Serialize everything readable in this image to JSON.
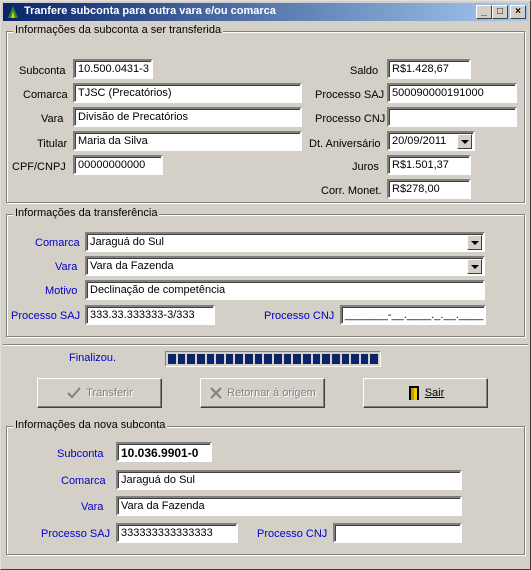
{
  "window": {
    "title": "Tranfere subconta para outra vara e/ou comarca",
    "min_label": "_",
    "max_label": "□",
    "close_label": "×"
  },
  "origem": {
    "title": "Informações da subconta a ser transferida",
    "subconta_label": "Subconta",
    "subconta": "10.500.0431-3",
    "comarca_label": "Comarca",
    "comarca": "TJSC (Precatórios)",
    "vara_label": "Vara",
    "vara": "Divisão de Precatórios",
    "titular_label": "Titular",
    "titular": "Maria da Silva",
    "cpf_label": "CPF/CNPJ",
    "cpf": "00000000000",
    "saldo_label": "Saldo",
    "saldo": "R$1.428,67",
    "saj_label": "Processo SAJ",
    "saj": "500090000191000",
    "cnj_label": "Processo CNJ",
    "cnj": "",
    "aniv_label": "Dt. Aniversário",
    "aniv": "20/09/2011",
    "juros_label": "Juros",
    "juros": "R$1.501,37",
    "corr_label": "Corr. Monet.",
    "corr": "R$278,00"
  },
  "transferencia": {
    "title": "Informações da transferência",
    "comarca_label": "Comarca",
    "comarca": "Jaraguá do Sul",
    "vara_label": "Vara",
    "vara": "Vara da Fazenda",
    "motivo_label": "Motivo",
    "motivo": "Declinação de competência",
    "saj_label": "Processo SAJ",
    "saj": "333.33.333333-3/333",
    "cnj_label": "Processo CNJ",
    "cnj": "_______-__.____._.__.____"
  },
  "status": {
    "label": "Finalizou.",
    "progress": 1.0,
    "progress_blocks": 22
  },
  "actions": {
    "transferir": "Transferir",
    "retornar": "Retornar à origem",
    "sair": "Sair"
  },
  "nova": {
    "title": "Informações da nova subconta",
    "subconta_label": "Subconta",
    "subconta": "10.036.9901-0",
    "comarca_label": "Comarca",
    "comarca": "Jaraguá do Sul",
    "vara_label": "Vara",
    "vara": "Vara da Fazenda",
    "saj_label": "Processo SAJ",
    "saj": "333333333333333",
    "cnj_label": "Processo CNJ",
    "cnj": ""
  }
}
